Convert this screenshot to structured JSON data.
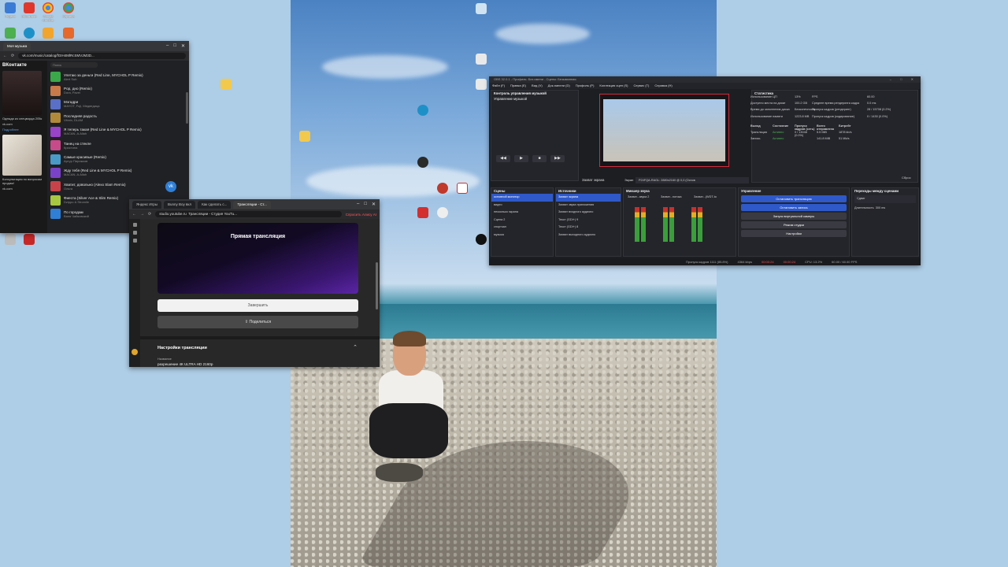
{
  "vk": {
    "tab_title": "Моя музыка",
    "url": "vk.com/music/catalog/fGIH4MlRcSMVJM3D...",
    "logo": "ВКонтакте",
    "search_placeholder": "Поиск",
    "ad1_text": "Одежда из спецворда 205к",
    "ad1_site": "vk.com",
    "ad1_btn": "Подробнее",
    "ad2_text": "Консультация по вопросам продаж!",
    "ad2_site": "vk.com",
    "tracks": [
      {
        "title": "Улетаю за деньги (Red Line, MYCHOL P Remix)",
        "artist": "Alert Sub",
        "color": "#3aa84a"
      },
      {
        "title": "Pop, дно (Remix)",
        "artist": "Dora, Pavel",
        "color": "#c87a4a"
      },
      {
        "title": "Мэгадри",
        "artist": "MAYOT, Fuji, Медведица",
        "color": "#5a6fc7"
      },
      {
        "title": "Последняя радость",
        "artist": "Vitmix, DLAM",
        "color": "#b08a3a"
      },
      {
        "title": "Я теперь такая (Red Line & MYCHOL P Remix)",
        "artist": "MACAN, A.Allah",
        "color": "#9a42c8"
      },
      {
        "title": "Танец на стекле",
        "artist": "Кристина",
        "color": "#c84a8a"
      },
      {
        "title": "Самые красивые (Remix)",
        "artist": "Артур Пирожков",
        "color": "#4a9ac8"
      },
      {
        "title": "Жду тебя (Red Line & MYCHOL P Remix)",
        "artist": "MACAN, A.Allah",
        "color": "#7a42c8"
      },
      {
        "title": "Хватит, довольно (Alexx Slam Remix)",
        "artist": "Ольга",
        "color": "#c8424a"
      },
      {
        "title": "Фиеста (Silver Ace & Slim Remix)",
        "artist": "Dzippo & Stromile",
        "color": "#a8c842"
      },
      {
        "title": "По городам",
        "artist": "Ваня Чайковский",
        "color": "#2f7fd6"
      }
    ]
  },
  "youtube": {
    "tabs": [
      "Яндекс Игры",
      "Bunny Boy вкл",
      "Как сделать с...",
      "Трансляции - Ст..."
    ],
    "url": "studio.youtube.ru",
    "url_title": "Трансляции - Студия YouTu...",
    "ask_alice": "Спросить Алису AI",
    "preview_title": "Прямая трансляция",
    "end_button": "Завершить",
    "share_button": "Поделиться",
    "settings_title": "Настройки трансляции",
    "name_label": "Название",
    "resolution": "разрешение 4К ULTRA HD 2160p"
  },
  "obs": {
    "title": "OBS 32.0.1 - Профиль: Без имени - Сцены: Безымянная",
    "menu": [
      "Файл (F)",
      "Правка (E)",
      "Вид (V)",
      "Док-панели (D)",
      "Профиль (P)",
      "Коллекция сцен (S)",
      "Сервис (T)",
      "Справка (H)"
    ],
    "music_dock_title": "Контроль управления музыкой",
    "music_sub": "Управление музыкой",
    "stats_title": "Статистика",
    "stats": [
      [
        "Использование ЦП",
        "13%",
        "FPS",
        "60.00"
      ],
      [
        "Доступно места на диске",
        "100.2 GB",
        "Среднее время рендеринга кадра",
        "0.0 ms"
      ],
      [
        "Время до заполнения диска",
        "Бесконечность",
        "Пропуск кадров (рендеринг)",
        "28 / 15708 (0.2%)"
      ],
      [
        "Использование памяти",
        "1223.8 MB",
        "Пропуск кадров (кодирование)",
        "0 / 1430 (0.0%)"
      ]
    ],
    "output_header": [
      "Выход",
      "Состояние",
      "Пропуск кадров (сеть)",
      "Всего отправлено",
      "Битрейт"
    ],
    "outputs": [
      [
        "Трансляция",
        "Активно",
        "0 / 13048 (0.0%)",
        "5.5 MiB",
        "1878 kb/s"
      ],
      [
        "Запись",
        "Активно",
        "",
        "141.8 MiB",
        "51 Mb/s"
      ]
    ],
    "reset_label": "Сброс",
    "preview_label": "Захват экрана",
    "screen_label": "Экран",
    "screen_value": "P24FQA-RAGL: 2880x2160 @ 0,0 (Основ",
    "scenes_title": "Сцены",
    "scenes": [
      "основной монитор",
      "видео",
      "несколько экрана",
      "Сцена 2",
      "спортзал",
      "музыка"
    ],
    "sources_title": "Источники",
    "sources": [
      "Захват экрана",
      "Захват звука приложения",
      "Захват входного аудиопо",
      "Текст (GDI+) 9",
      "Текст (GDI+) 8",
      "Захват выходного аудиопо"
    ],
    "mixer_title": "Микшер звука",
    "mixer_channels": [
      "Захват...звука 2",
      "Захват...потока",
      "Захват...(WDT-to"
    ],
    "controls_title": "Управление",
    "controls": [
      "Остановить трансляцию",
      "Остановить запись",
      "Запуск виртуальной камеры",
      "Режим студии",
      "Настройки"
    ],
    "transitions_title": "Переходы между сценами",
    "transition": "Сдвиг",
    "duration_label": "Длительность",
    "duration": "300 ms",
    "statusbar": [
      "Пропуск кадров 1111 (85.8%)",
      "4364 kbps",
      "00:00:24",
      "00:00:24",
      "CPU: 13.2%",
      "60.00 / 60.00 FPS"
    ]
  },
  "desktop_icons": [
    "Яндекс",
    "ВКонтакте",
    "Google Chrome",
    "Корзина",
    "Telegram",
    "Edge",
    "Дубли",
    "Видео",
    "OBS Studio",
    "Фото",
    "Музыка",
    "Мастер",
    "Word"
  ]
}
